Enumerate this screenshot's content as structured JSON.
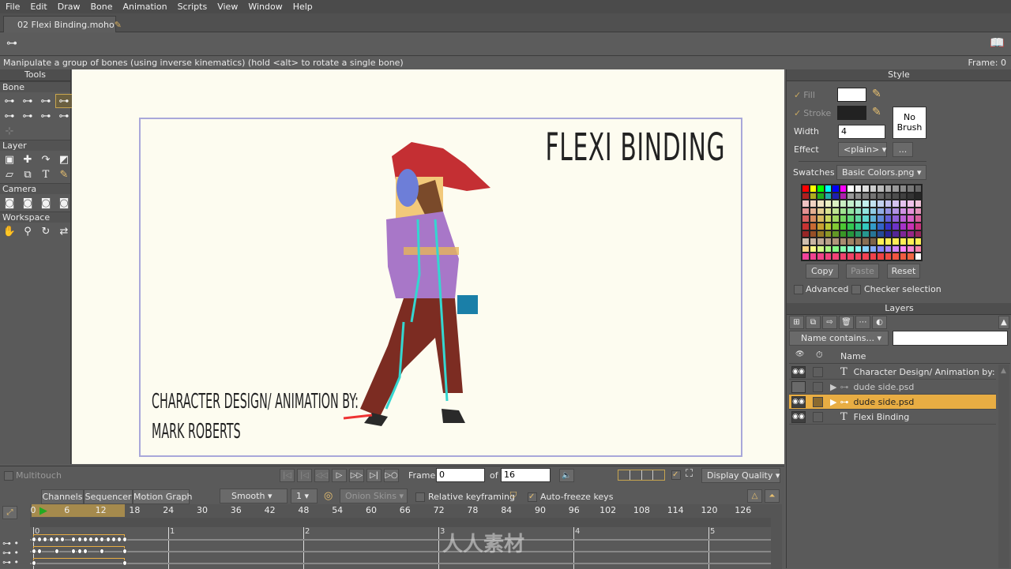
{
  "menu": [
    "File",
    "Edit",
    "Draw",
    "Bone",
    "Animation",
    "Scripts",
    "View",
    "Window",
    "Help"
  ],
  "document_tab": "02 Flexi Binding.moho",
  "status_message": "Manipulate a group of bones (using inverse kinematics) (hold <alt> to rotate a single bone)",
  "frame_readout": "Frame: 0",
  "tools": {
    "title": "Tools",
    "sections": [
      "Bone",
      "Layer",
      "Camera",
      "Workspace"
    ]
  },
  "canvas": {
    "title": "FLEXI BINDING",
    "credit_line1": "CHARACTER DESIGN/ ANIMATION BY:",
    "credit_line2": "MARK ROBERTS"
  },
  "style": {
    "title": "Style",
    "fill_label": "Fill",
    "stroke_label": "Stroke",
    "width_label": "Width",
    "width_value": "4",
    "effect_label": "Effect",
    "effect_value": "<plain>",
    "effect_more": "...",
    "no_brush": "No Brush",
    "swatches_label": "Swatches",
    "swatches_value": "Basic Colors.png",
    "copy": "Copy",
    "paste": "Paste",
    "reset": "Reset",
    "advanced": "Advanced",
    "checker": "Checker selection",
    "fill_color": "#ffffff",
    "stroke_color": "#222222"
  },
  "layers": {
    "title": "Layers",
    "filter": "Name contains...",
    "filter_value": "",
    "name_header": "Name",
    "rows": [
      {
        "name": "Character Design/ Animation by:  Ma",
        "type": "text",
        "visible": true,
        "selected": false
      },
      {
        "name": "dude side.psd",
        "type": "bone",
        "visible": false,
        "selected": false
      },
      {
        "name": "dude side.psd",
        "type": "bone",
        "visible": true,
        "selected": true
      },
      {
        "name": "Flexi Binding",
        "type": "text",
        "visible": true,
        "selected": false
      }
    ]
  },
  "playback": {
    "multitouch": "Multitouch",
    "frame_label": "Frame",
    "frame_value": "0",
    "of_label": "of",
    "total_frames": "16",
    "display_quality": "Display Quality"
  },
  "timeline": {
    "tabs": [
      "Channels",
      "Sequencer",
      "Motion Graph"
    ],
    "interpolation": "Smooth",
    "interp_count": "1",
    "onion_skins": "Onion Skins",
    "relative_keyframing": "Relative keyframing",
    "auto_freeze": "Auto-freeze keys",
    "auto_freeze_checked": true,
    "ruler_ticks": [
      "0",
      "6",
      "12",
      "18",
      "24",
      "30",
      "36",
      "42",
      "48",
      "54",
      "60",
      "66",
      "72",
      "78",
      "84",
      "90",
      "96",
      "102",
      "108",
      "114",
      "120",
      "126"
    ],
    "second_markers": [
      "0",
      "1",
      "2",
      "3",
      "4",
      "5"
    ],
    "accent": "#e8ad43"
  },
  "watermark": "人人素材"
}
